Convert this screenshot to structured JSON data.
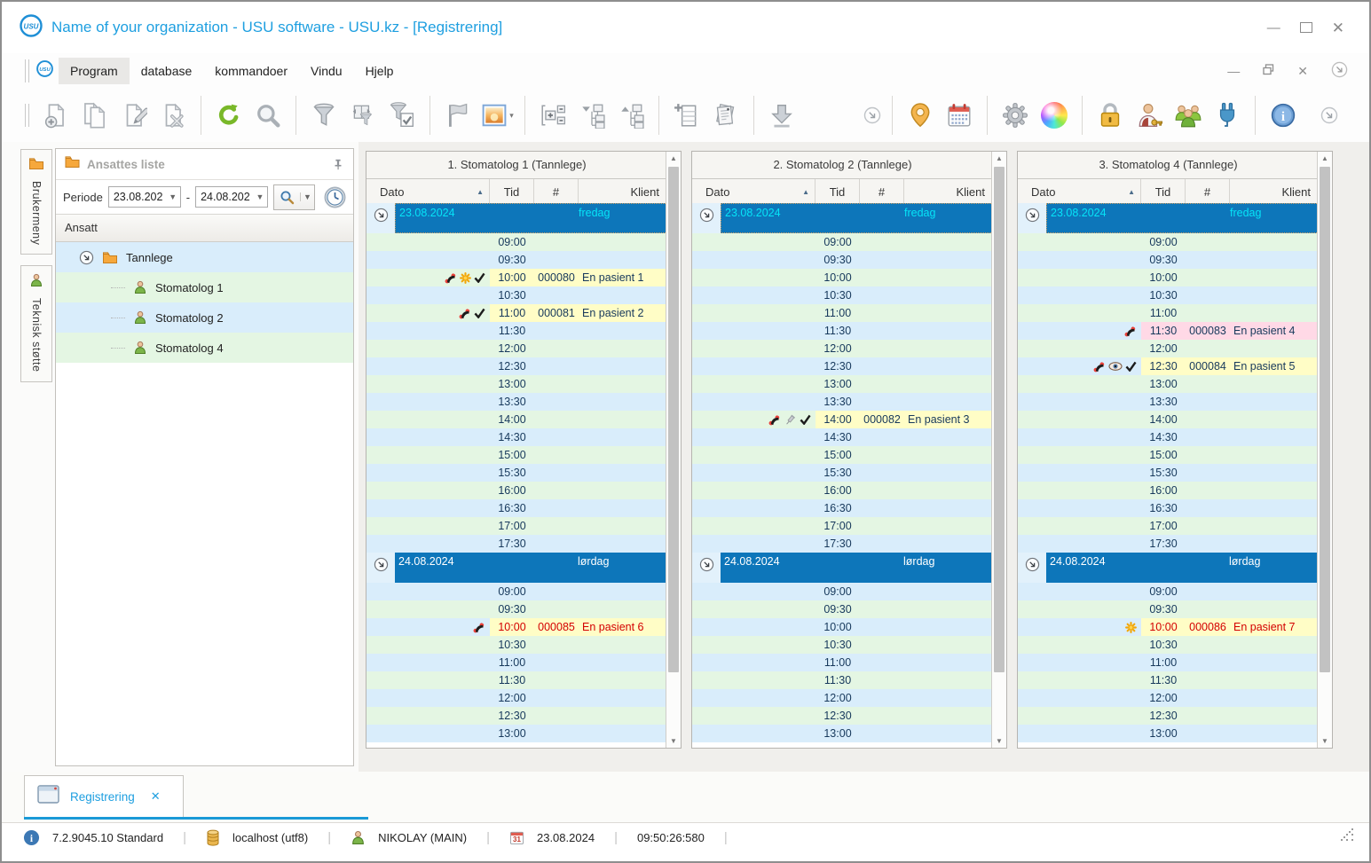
{
  "window": {
    "title": "Name of your organization - USU software - USU.kz - [Registrering]",
    "menu": [
      "Program",
      "database",
      "kommandoer",
      "Vindu",
      "Hjelp"
    ],
    "active_menu": "Program"
  },
  "colors": {
    "titleBlue": "#1e9fe0",
    "banner": "#0d76ba",
    "cyan": "#06e4f8",
    "rowGreen": "#e4f6e3",
    "rowBlue": "#d9edfb",
    "apptYellow": "#fffdc6",
    "apptPink": "#ffd9e6",
    "red": "#d40000",
    "navy": "#17395c",
    "iconCol": "#e2f1fb"
  },
  "toolbar": {
    "groups": [
      {
        "items": [
          {
            "icon": "new-record"
          },
          {
            "icon": "copy-record"
          },
          {
            "icon": "edit-record"
          },
          {
            "icon": "delete-record"
          }
        ]
      },
      {
        "items": [
          {
            "icon": "refresh"
          },
          {
            "icon": "search"
          }
        ]
      },
      {
        "items": [
          {
            "icon": "filter"
          },
          {
            "icon": "filter-panel"
          },
          {
            "icon": "filter-apply"
          }
        ]
      },
      {
        "items": [
          {
            "icon": "flag"
          },
          {
            "icon": "image-view",
            "dropdown": true
          }
        ]
      },
      {
        "items": [
          {
            "icon": "expand-groups"
          },
          {
            "icon": "collapse-tree"
          },
          {
            "icon": "expand-tree"
          }
        ]
      },
      {
        "items": [
          {
            "icon": "add-column"
          },
          {
            "icon": "report"
          }
        ]
      },
      {
        "items": [
          {
            "icon": "download"
          }
        ]
      },
      {
        "gap": 58,
        "nosep": true,
        "items": [
          {
            "icon": "chevron-circle",
            "small": true
          }
        ]
      },
      {
        "items": [
          {
            "icon": "location"
          },
          {
            "icon": "calendar"
          }
        ]
      },
      {
        "items": [
          {
            "icon": "settings-gear"
          },
          {
            "icon": "color-wheel"
          }
        ]
      },
      {
        "items": [
          {
            "icon": "lock"
          },
          {
            "icon": "user-key"
          },
          {
            "icon": "users-group"
          },
          {
            "icon": "plug"
          }
        ]
      },
      {
        "items": [
          {
            "icon": "info"
          }
        ]
      },
      {
        "gap": 8,
        "nosep": true,
        "items": [
          {
            "icon": "chevron-circle",
            "small": true
          }
        ]
      }
    ]
  },
  "sidebar": {
    "vertical_tabs": [
      {
        "label": "Brukermeny",
        "icon": "folder"
      },
      {
        "label": "Teknisk støtte",
        "icon": "person"
      }
    ],
    "panel_title": "Ansattes liste",
    "periode": {
      "label": "Periode",
      "from": "23.08.202",
      "to": "24.08.202",
      "dash": "-"
    },
    "tree": {
      "header": "Ansatt",
      "root": "Tannlege",
      "children": [
        "Stomatolog 1",
        "Stomatolog 2",
        "Stomatolog 4"
      ]
    }
  },
  "schedule": {
    "headers": {
      "dato": "Dato",
      "tid": "Tid",
      "num": "#",
      "klient": "Klient"
    },
    "day_sections": [
      {
        "date": "23.08.2024",
        "weekday": "fredag",
        "selected": true,
        "first_stripe": "green",
        "times": [
          "09:00",
          "09:30",
          "10:00",
          "10:30",
          "11:00",
          "11:30",
          "12:00",
          "12:30",
          "13:00",
          "13:30",
          "14:00",
          "14:30",
          "15:00",
          "15:30",
          "16:00",
          "16:30",
          "17:00",
          "17:30"
        ]
      },
      {
        "date": "24.08.2024",
        "weekday": "lørdag",
        "selected": false,
        "first_stripe": "blue",
        "times": [
          "09:00",
          "09:30",
          "10:00",
          "10:30",
          "11:00",
          "11:30",
          "12:00",
          "12:30",
          "13:00"
        ]
      }
    ],
    "columns": [
      {
        "title": "1. Stomatolog 1 (Tannlege)",
        "appointments": [
          {
            "day": 0,
            "time": "10:00",
            "num": "000080",
            "client": "En pasient 1",
            "icons": [
              "phone",
              "sun",
              "check"
            ],
            "bg": "yellow",
            "text": "dark"
          },
          {
            "day": 0,
            "time": "11:00",
            "num": "000081",
            "client": "En pasient 2",
            "icons": [
              "phone",
              "check"
            ],
            "bg": "yellow",
            "text": "dark"
          },
          {
            "day": 1,
            "time": "10:00",
            "num": "000085",
            "client": "En pasient 6",
            "icons": [
              "phone"
            ],
            "bg": "yellow",
            "text": "red"
          }
        ]
      },
      {
        "title": "2. Stomatolog 2 (Tannlege)",
        "appointments": [
          {
            "day": 0,
            "time": "14:00",
            "num": "000082",
            "client": "En pasient 3",
            "icons": [
              "phone",
              "syringe",
              "check"
            ],
            "bg": "yellow",
            "text": "dark"
          }
        ]
      },
      {
        "title": "3. Stomatolog 4 (Tannlege)",
        "appointments": [
          {
            "day": 0,
            "time": "11:30",
            "num": "000083",
            "client": "En pasient 4",
            "icons": [
              "phone"
            ],
            "bg": "pink",
            "text": "dark"
          },
          {
            "day": 0,
            "time": "12:30",
            "num": "000084",
            "client": "En pasient 5",
            "icons": [
              "phone",
              "eye",
              "check"
            ],
            "bg": "yellow",
            "text": "dark"
          },
          {
            "day": 1,
            "time": "10:00",
            "num": "000086",
            "client": "En pasient 7",
            "icons": [
              "sun"
            ],
            "bg": "yellow",
            "text": "red"
          }
        ]
      }
    ]
  },
  "bottom_tab": {
    "label": "Registrering",
    "close": "✕"
  },
  "status_bar": {
    "items": [
      {
        "icon": "info-circle",
        "text": "7.2.9045.10 Standard"
      },
      {
        "icon": "database",
        "text": "localhost (utf8)"
      },
      {
        "icon": "user",
        "text": "NIKOLAY (MAIN)"
      },
      {
        "icon": "calendar-small",
        "text": "23.08.2024"
      },
      {
        "icon": null,
        "text": "09:50:26:580"
      }
    ]
  }
}
